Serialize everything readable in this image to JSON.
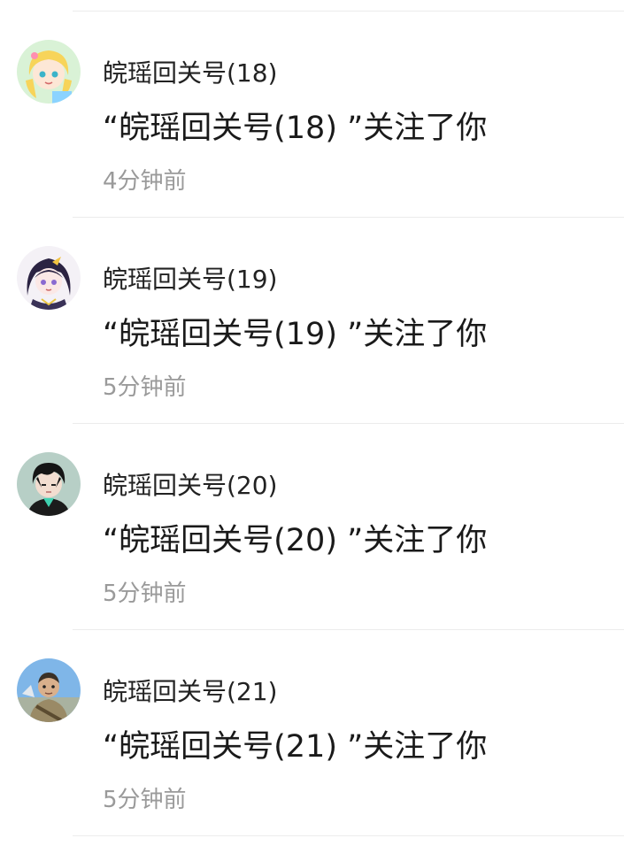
{
  "notifications": [
    {
      "avatar_icon": "anime-girl-blonde-avatar-icon",
      "name": "皖瑶回关号(18)",
      "message": "“皖瑶回关号(18) ”关注了你",
      "time": "4分钟前"
    },
    {
      "avatar_icon": "anime-girl-dark-hair-avatar-icon",
      "name": "皖瑶回关号(19)",
      "message": "“皖瑶回关号(19) ”关注了你",
      "time": "5分钟前"
    },
    {
      "avatar_icon": "anime-boy-black-hair-avatar-icon",
      "name": "皖瑶回关号(20)",
      "message": "“皖瑶回关号(20) ”关注了你",
      "time": "5分钟前"
    },
    {
      "avatar_icon": "game-character-warrior-avatar-icon",
      "name": "皖瑶回关号(21)",
      "message": "“皖瑶回关号(21) ”关注了你",
      "time": "5分钟前"
    }
  ]
}
